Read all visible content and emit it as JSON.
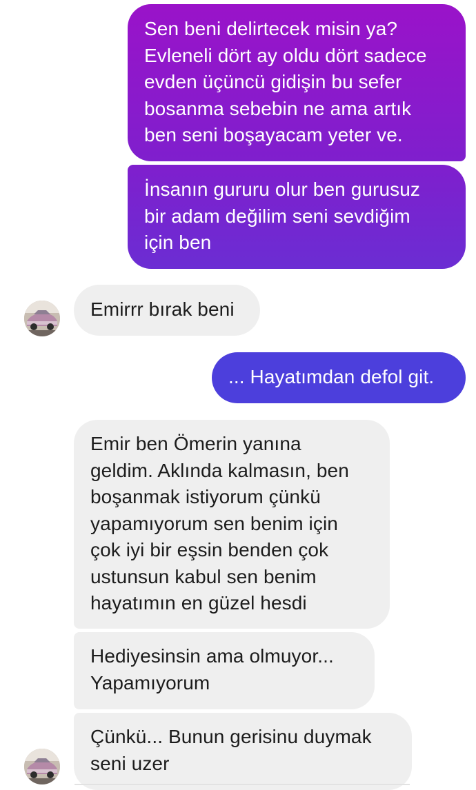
{
  "conversation": {
    "messages": [
      {
        "direction": "outgoing",
        "text": "Sen beni delirtecek misin ya?\nEvleneli dört ay oldu dört sadece\nevden üçüncü gidişin bu sefer\nbosanma sebebin ne ama artık\nben seni boşayacam yeter ve."
      },
      {
        "direction": "outgoing",
        "text": "İnsanın gururu olur ben gurusuz\nbir adam değilim seni sevdiğim\niçin ben"
      },
      {
        "direction": "incoming",
        "text": "Emirrr bırak beni"
      },
      {
        "direction": "outgoing",
        "text": "... Hayatımdan defol git."
      },
      {
        "direction": "incoming",
        "text": "Emir ben Ömerin yanına\ngeldim. Aklında kalmasın, ben\nboşanmak istiyorum çünkü\nyapamıyorum sen benim için\nçok iyi bir eşsin benden çok\nustunsun kabul sen benim\nhayatımın en güzel hesdi"
      },
      {
        "direction": "incoming",
        "text": "Hediyesinsin ama olmuyor...\nYapamıyorum"
      },
      {
        "direction": "incoming",
        "text": "Çünkü... Bunun gerisinu duymak\nseni uzer"
      }
    ]
  },
  "colors": {
    "outgoing_gradient_top": "#9a13c9",
    "outgoing_gradient_bottom": "#4a42d8",
    "incoming_bubble": "#efefef",
    "incoming_text": "#1c1c1c",
    "outgoing_text": "#ffffff"
  },
  "avatar": {
    "icon": "vintage-car-icon"
  }
}
